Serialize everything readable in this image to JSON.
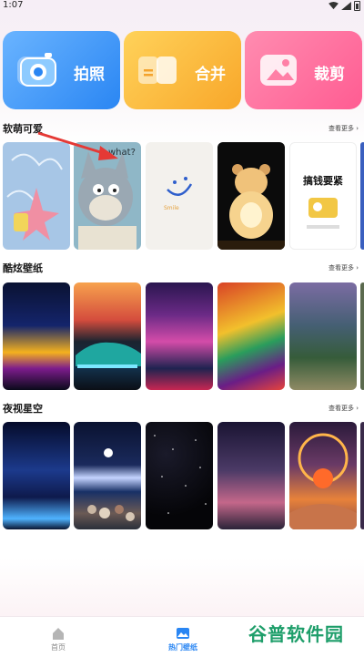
{
  "status_bar": {
    "time": "1:07"
  },
  "tools": [
    {
      "label": "拍照",
      "icon": "camera-icon",
      "color": "#3d8ef7"
    },
    {
      "label": "合并",
      "icon": "merge-icon",
      "color": "#f9b13a"
    },
    {
      "label": "裁剪",
      "icon": "image-crop-icon",
      "color": "#ff6a9b"
    }
  ],
  "sections": [
    {
      "title": "软萌可爱",
      "more": "查看更多 ›"
    },
    {
      "title": "酷炫壁纸",
      "more": "查看更多 ›"
    },
    {
      "title": "夜视星空",
      "more": "查看更多 ›"
    }
  ],
  "tile_text": {
    "tom_text": "what?",
    "smile_text": "Smile",
    "poster_title": "搞钱要紧"
  },
  "bottom_nav": [
    {
      "label": "首页",
      "icon": "home-icon"
    },
    {
      "label": "热门壁纸",
      "icon": "wallpaper-icon"
    }
  ],
  "watermark": "谷普软件园",
  "colors": {
    "accent": "#2a86f3",
    "watermark": "#1e9e6a"
  }
}
